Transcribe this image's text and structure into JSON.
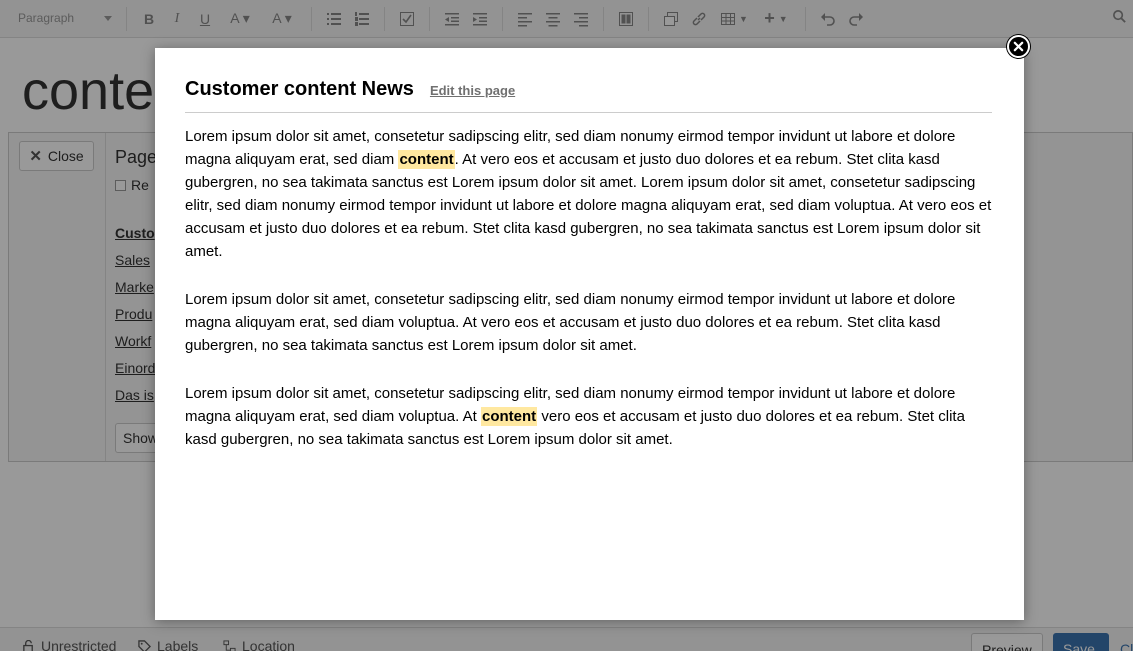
{
  "toolbar": {
    "paragraph_label": "Paragraph"
  },
  "background": {
    "page_title": "conte",
    "close_label": "Close",
    "panel_heading": "Page",
    "checkbox_label": "Re",
    "links": [
      "Custo",
      "Sales",
      "Marke",
      "Produ",
      "Workf",
      "Einord",
      "Das is"
    ],
    "show_label": "Show"
  },
  "footer": {
    "restrictions": "Unrestricted",
    "labels": "Labels",
    "location": "Location",
    "preview": "Preview",
    "save": "Save",
    "close": "Cl"
  },
  "dialog": {
    "title": "Customer content News",
    "edit_link": "Edit this page",
    "paragraph1_part1": "Lorem ipsum dolor sit amet, consetetur sadipscing elitr, sed diam nonumy eirmod tempor invidunt ut labore et dolore magna aliquyam erat, sed diam ",
    "paragraph1_highlight": "content",
    "paragraph1_part2": ". At vero eos et accusam et justo duo dolores et ea rebum. Stet clita kasd gubergren, no sea takimata sanctus est Lorem ipsum dolor sit amet. Lorem ipsum dolor sit amet, consetetur sadipscing elitr, sed diam nonumy eirmod tempor invidunt ut labore et dolore magna aliquyam erat, sed diam voluptua. At vero eos et accusam et justo duo dolores et ea rebum. Stet clita kasd gubergren, no sea takimata sanctus est Lorem ipsum dolor sit amet.",
    "paragraph2": "Lorem ipsum dolor sit amet, consetetur sadipscing elitr, sed diam nonumy eirmod tempor invidunt ut labore et dolore magna aliquyam erat, sed diam voluptua. At vero eos et accusam et justo duo dolores et ea rebum. Stet clita kasd gubergren, no sea takimata sanctus est Lorem ipsum dolor sit amet.",
    "paragraph3_part1": "Lorem ipsum dolor sit amet, consetetur sadipscing elitr, sed diam nonumy eirmod tempor invidunt ut labore et dolore magna aliquyam erat, sed diam voluptua. At ",
    "paragraph3_highlight": "content",
    "paragraph3_part2": " vero eos et accusam et justo duo dolores et ea rebum. Stet clita kasd gubergren, no sea takimata sanctus est Lorem ipsum dolor sit amet."
  },
  "colors": {
    "highlight": "#ffe8a0",
    "accent": "#3b73af",
    "overlay": "rgba(0,0,0,0.4)"
  }
}
